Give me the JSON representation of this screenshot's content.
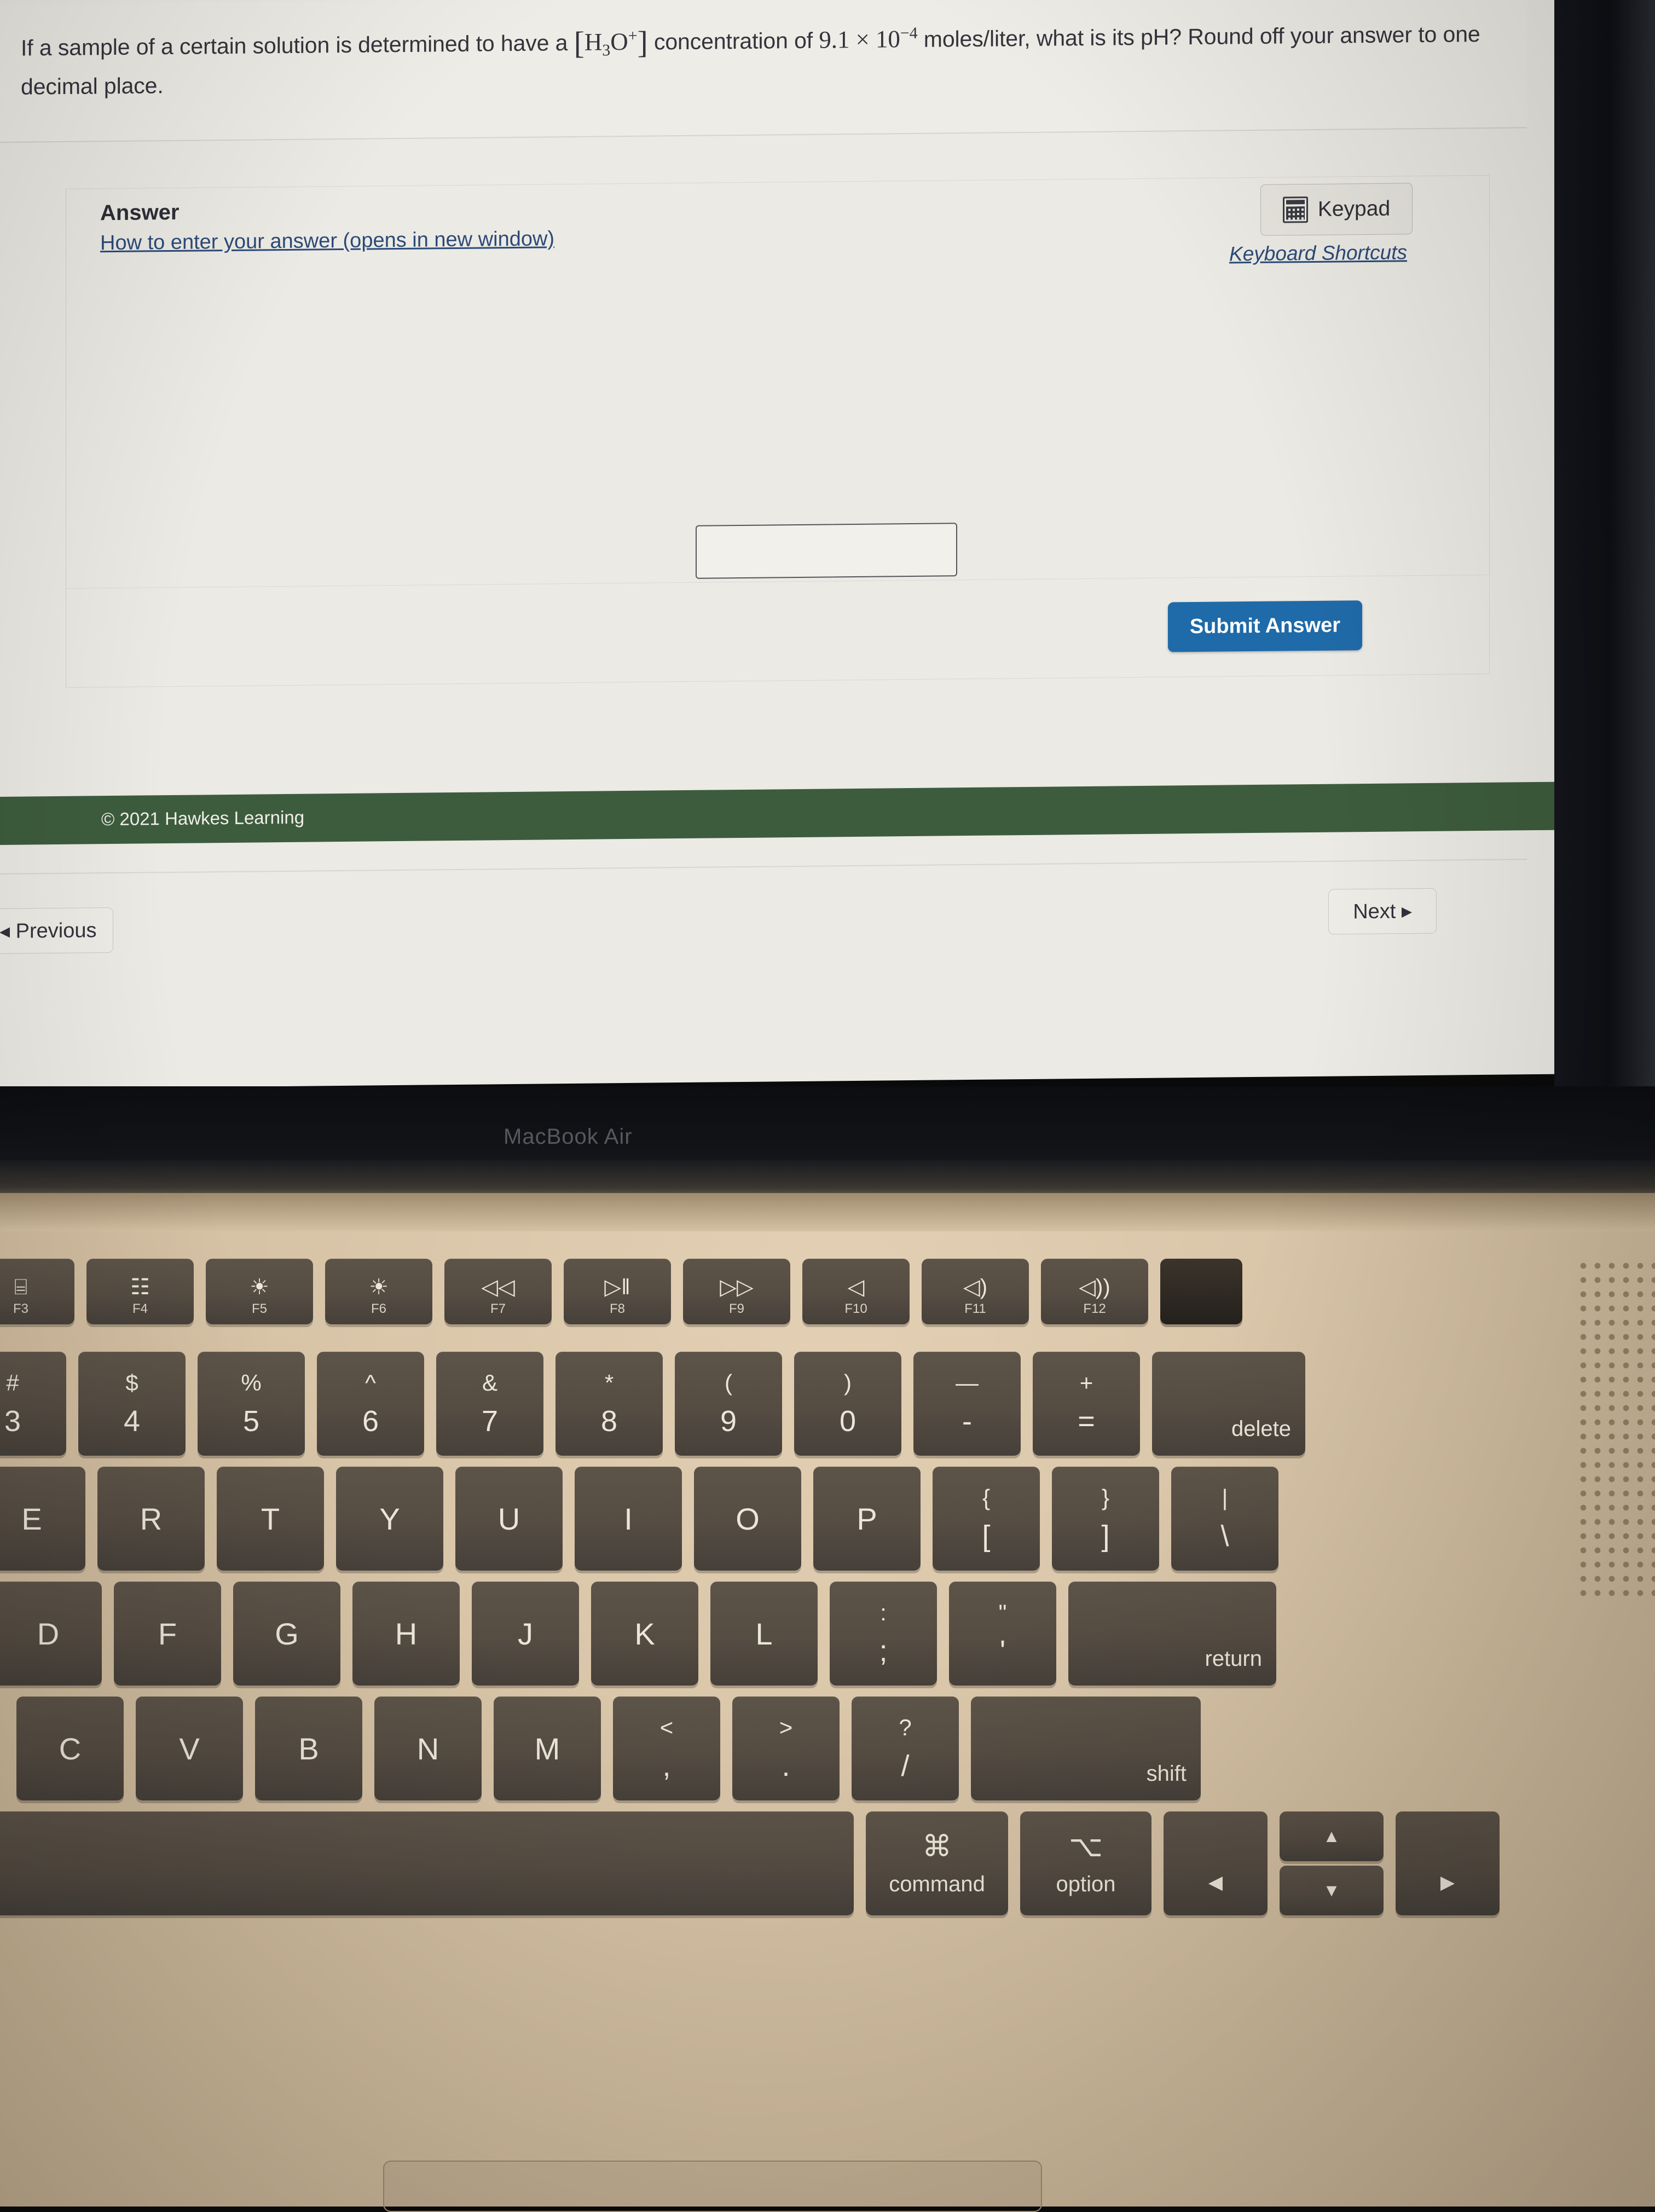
{
  "question": {
    "lead": "If a sample of a certain solution is determined to have a",
    "formula_open": "[",
    "formula_h": "H",
    "formula_3": "3",
    "formula_o": "O",
    "formula_plus": "+",
    "formula_close": "]",
    "mid": "concentration of",
    "value_mantissa": "9.1",
    "times": "×",
    "base": "10",
    "exponent": "−4",
    "units_and_prompt": "moles/liter, what is its pH?",
    "rounding": "Round off your answer to one decimal place."
  },
  "answer_panel": {
    "label": "Answer",
    "howto_link": "How to enter your answer (opens in new window)",
    "keypad_button": "Keypad",
    "keypad_icon": "calculator-icon",
    "keyboard_shortcuts_link": "Keyboard Shortcuts",
    "input_value": "",
    "input_placeholder": "",
    "submit_button": "Submit Answer"
  },
  "footer": {
    "copyright": "© 2021 Hawkes Learning"
  },
  "navigation": {
    "previous": "◂ Previous",
    "next": "Next ▸"
  },
  "colors": {
    "submit_blue": "#1f6aa8",
    "footer_green": "#3d5c3d",
    "link_blue": "#2b4a78",
    "page_bg": "#eceae4"
  },
  "device": {
    "bezel_label": "MacBook Air"
  },
  "keyboard": {
    "function_row": [
      {
        "glyph": "⌸",
        "fn": "F3",
        "name": "mission-control"
      },
      {
        "glyph": "☷",
        "fn": "F4",
        "name": "launchpad"
      },
      {
        "glyph": "☀",
        "fn": "F5",
        "name": "keyboard-brightness-down"
      },
      {
        "glyph": "☀",
        "fn": "F6",
        "name": "keyboard-brightness-up"
      },
      {
        "glyph": "◁◁",
        "fn": "F7",
        "name": "rewind"
      },
      {
        "glyph": "▷‖",
        "fn": "F8",
        "name": "play-pause"
      },
      {
        "glyph": "▷▷",
        "fn": "F9",
        "name": "fast-forward"
      },
      {
        "glyph": "◁",
        "fn": "F10",
        "name": "mute"
      },
      {
        "glyph": "◁)",
        "fn": "F11",
        "name": "volume-down"
      },
      {
        "glyph": "◁))",
        "fn": "F12",
        "name": "volume-up"
      }
    ],
    "number_row": [
      {
        "top": "#",
        "bot": "3"
      },
      {
        "top": "$",
        "bot": "4"
      },
      {
        "top": "%",
        "bot": "5"
      },
      {
        "top": "^",
        "bot": "6"
      },
      {
        "top": "&",
        "bot": "7"
      },
      {
        "top": "*",
        "bot": "8"
      },
      {
        "top": "(",
        "bot": "9"
      },
      {
        "top": ")",
        "bot": "0"
      },
      {
        "top": "—",
        "bot": "-"
      },
      {
        "top": "+",
        "bot": "="
      }
    ],
    "delete_key": "delete",
    "top_letter_row": [
      "E",
      "R",
      "T",
      "Y",
      "U",
      "I",
      "O",
      "P"
    ],
    "bracket_keys": [
      {
        "top": "{",
        "bot": "["
      },
      {
        "top": "}",
        "bot": "]"
      },
      {
        "top": "|",
        "bot": "\\"
      }
    ],
    "home_row": [
      "D",
      "F",
      "G",
      "H",
      "J",
      "K",
      "L"
    ],
    "home_punct": [
      {
        "top": ":",
        "bot": ";"
      },
      {
        "top": "\"",
        "bot": "'"
      }
    ],
    "return_key": "return",
    "bottom_row": [
      "C",
      "V",
      "B",
      "N",
      "M"
    ],
    "bottom_punct": [
      {
        "top": "<",
        "bot": ","
      },
      {
        "top": ">",
        "bot": "."
      },
      {
        "top": "?",
        "bot": "/"
      }
    ],
    "shift_key": "shift",
    "command_key": {
      "glyph": "⌘",
      "label": "command"
    },
    "option_key": {
      "glyph": "⌥",
      "label": "option"
    },
    "arrows": {
      "left": "◀",
      "up": "▲",
      "down": "▼",
      "right": "▶"
    }
  }
}
